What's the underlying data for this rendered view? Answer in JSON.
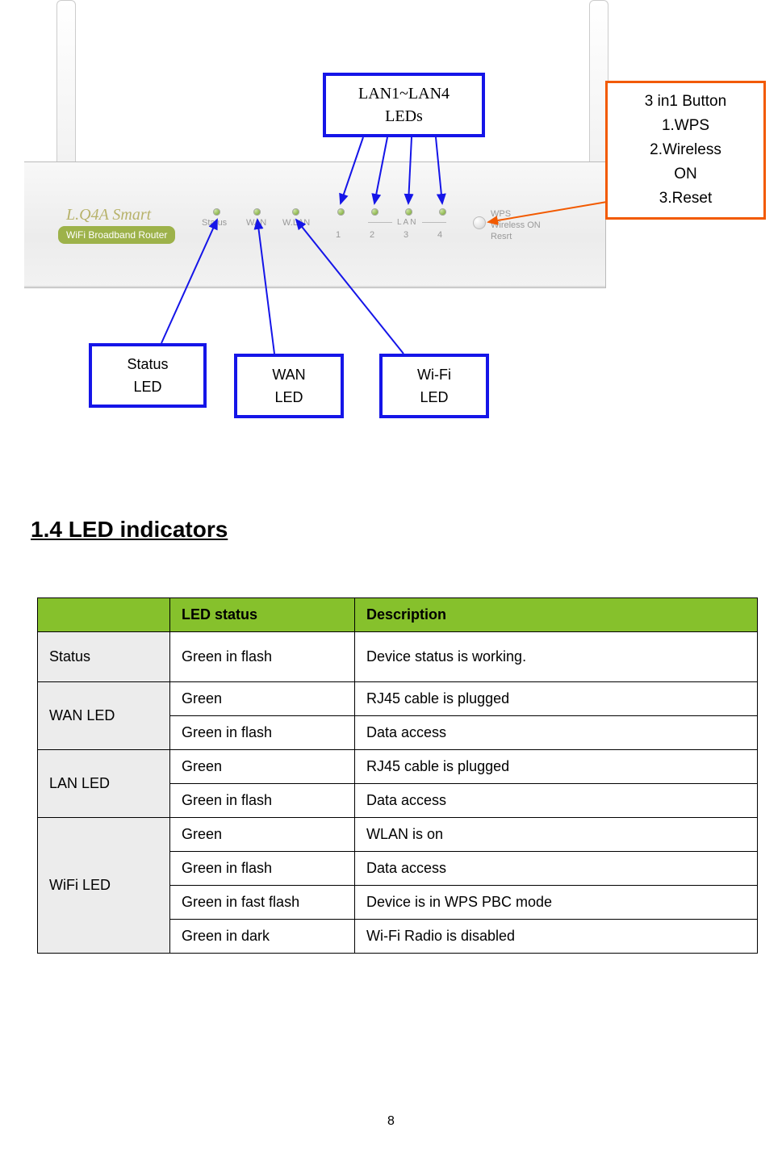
{
  "router": {
    "brand": "L.Q4A Smart",
    "badge": "WiFi Broadband Router",
    "labels": {
      "status": "Status",
      "wan": "WAN",
      "wlan": "W.LAN",
      "lan": "LAN",
      "n1": "1",
      "n2": "2",
      "n3": "3",
      "n4": "4",
      "wps": "WPS\nWireless ON\nResrt"
    }
  },
  "callouts": {
    "lan_leds": {
      "l1": "LAN1~LAN4",
      "l2": "LEDs"
    },
    "three_in_one": {
      "l1": "3 in1 Button",
      "l2": "1.WPS",
      "l3": "2.Wireless",
      "l4": "ON",
      "l5": "3.Reset"
    },
    "status_led": {
      "l1": "Status",
      "l2": "LED"
    },
    "wan_led": {
      "l1": "WAN",
      "l2": "LED"
    },
    "wifi_led": {
      "l1": "Wi-Fi",
      "l2": "LED"
    }
  },
  "section_title": "1.4 LED indicators",
  "table": {
    "header": {
      "c0": "",
      "c1": "LED status",
      "c2": "Description"
    },
    "rows": [
      {
        "name": "Status",
        "status": "Green in flash",
        "desc": "Device status is working."
      },
      {
        "name": "WAN LED",
        "status": "Green",
        "desc": "RJ45 cable is plugged"
      },
      {
        "name": "",
        "status": "Green in flash",
        "desc": "Data access"
      },
      {
        "name": "LAN LED",
        "status": "Green",
        "desc": "RJ45 cable is plugged"
      },
      {
        "name": "",
        "status": "Green in flash",
        "desc": "Data access"
      },
      {
        "name": "WiFi LED",
        "status": "Green",
        "desc": "WLAN is on"
      },
      {
        "name": "",
        "status": "Green in flash",
        "desc": "Data access"
      },
      {
        "name": "",
        "status": "Green in fast flash",
        "desc": "Device is in WPS PBC mode"
      },
      {
        "name": "",
        "status": "Green in dark",
        "desc": "Wi-Fi Radio is disabled"
      }
    ]
  },
  "page_number": "8"
}
